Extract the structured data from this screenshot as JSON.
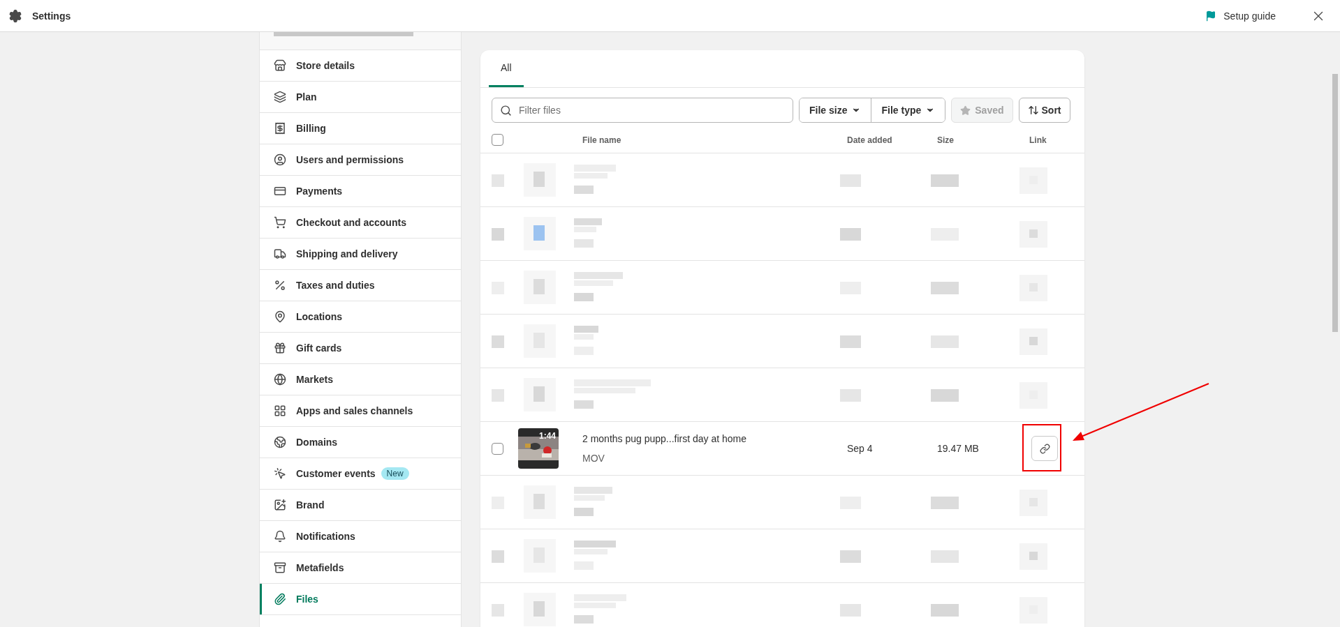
{
  "top_bar": {
    "title": "Settings",
    "setup_guide": "Setup guide"
  },
  "sidebar": {
    "items": [
      {
        "label": "Store details",
        "selected": false
      },
      {
        "label": "Plan",
        "selected": false
      },
      {
        "label": "Billing",
        "selected": false
      },
      {
        "label": "Users and permissions",
        "selected": false
      },
      {
        "label": "Payments",
        "selected": false
      },
      {
        "label": "Checkout and accounts",
        "selected": false
      },
      {
        "label": "Shipping and delivery",
        "selected": false
      },
      {
        "label": "Taxes and duties",
        "selected": false
      },
      {
        "label": "Locations",
        "selected": false
      },
      {
        "label": "Gift cards",
        "selected": false
      },
      {
        "label": "Markets",
        "selected": false
      },
      {
        "label": "Apps and sales channels",
        "selected": false
      },
      {
        "label": "Domains",
        "selected": false
      },
      {
        "label": "Customer events",
        "badge": "New",
        "selected": false
      },
      {
        "label": "Brand",
        "selected": false
      },
      {
        "label": "Notifications",
        "selected": false
      },
      {
        "label": "Metafields",
        "selected": false
      },
      {
        "label": "Files",
        "selected": true
      }
    ]
  },
  "tabs": [
    {
      "label": "All",
      "selected": true
    }
  ],
  "toolbar": {
    "search": {
      "placeholder": "Filter files"
    },
    "filters": [
      "File size",
      "File type"
    ],
    "saved": {
      "label": "Saved",
      "disabled": true
    },
    "sort": "Sort"
  },
  "table": {
    "select_all_checked": false,
    "columns": [
      "File name",
      "Date added",
      "Size",
      "Link"
    ],
    "rows": [
      {
        "kind": "redacted"
      },
      {
        "kind": "redacted"
      },
      {
        "kind": "redacted"
      },
      {
        "kind": "redacted"
      },
      {
        "kind": "redacted"
      },
      {
        "kind": "file",
        "checked": false,
        "duration": "1:44",
        "name": "2 months pug pupp...first day at home",
        "type": "MOV",
        "date": "Sep 4",
        "size": "19.47 MB",
        "highlighted": true
      },
      {
        "kind": "redacted"
      },
      {
        "kind": "redacted"
      },
      {
        "kind": "redacted"
      }
    ]
  }
}
